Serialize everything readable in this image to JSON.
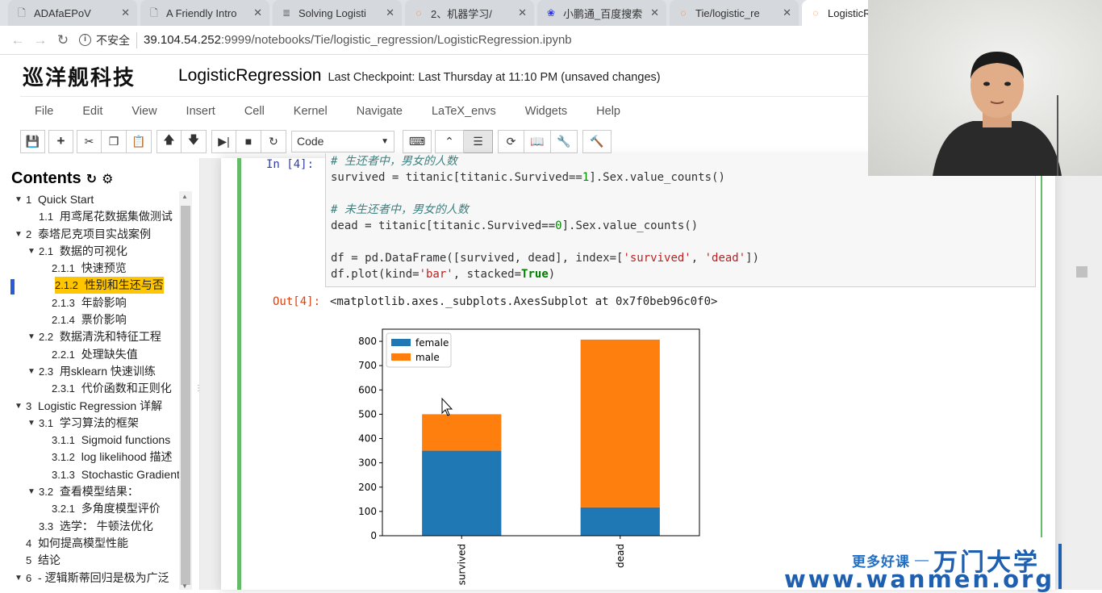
{
  "browser": {
    "tabs": [
      {
        "label": "ADAfaEPoV",
        "icon": "page-icon"
      },
      {
        "label": "A Friendly Intro",
        "icon": "page-icon"
      },
      {
        "label": "Solving Logisti",
        "icon": "doc-icon"
      },
      {
        "label": "2、机器学习/",
        "icon": "jupyter-icon"
      },
      {
        "label": "小鹏通_百度搜索",
        "icon": "baidu-icon"
      },
      {
        "label": "Tie/logistic_re",
        "icon": "jupyter-icon"
      },
      {
        "label": "LogisticRegres",
        "icon": "jupyter-icon"
      }
    ],
    "security_label": "不安全",
    "url_host": "39.104.54.252",
    "url_path": ":9999/notebooks/Tie/logistic_regression/LogisticRegression.ipynb"
  },
  "header": {
    "logo": "巡洋舰科技",
    "notebook_name": "LogisticRegression",
    "checkpoint": "Last Checkpoint: Last Thursday at 11:10 PM (unsaved changes)"
  },
  "menu": [
    "File",
    "Edit",
    "View",
    "Insert",
    "Cell",
    "Kernel",
    "Navigate",
    "LaTeX_envs",
    "Widgets",
    "Help"
  ],
  "toolbar": {
    "cell_type": "Code"
  },
  "toc": {
    "title": "Contents",
    "items": [
      {
        "num": "1",
        "text": "Quick Start",
        "level": 1,
        "arrow": true
      },
      {
        "num": "1.1",
        "text": "用鸢尾花数据集做测试",
        "level": 2,
        "arrow": false
      },
      {
        "num": "2",
        "text": "泰塔尼克项目实战案例",
        "level": 1,
        "arrow": true
      },
      {
        "num": "2.1",
        "text": "数据的可视化",
        "level": 2,
        "arrow": true
      },
      {
        "num": "2.1.1",
        "text": "快速预览",
        "level": 3,
        "arrow": false
      },
      {
        "num": "2.1.2",
        "text": "性别和生还与否",
        "level": 3,
        "arrow": false,
        "active": true
      },
      {
        "num": "2.1.3",
        "text": "年龄影响",
        "level": 3,
        "arrow": false
      },
      {
        "num": "2.1.4",
        "text": "票价影响",
        "level": 3,
        "arrow": false
      },
      {
        "num": "2.2",
        "text": "数据清洗和特征工程",
        "level": 2,
        "arrow": true
      },
      {
        "num": "2.2.1",
        "text": "处理缺失值",
        "level": 3,
        "arrow": false
      },
      {
        "num": "2.3",
        "text": "用sklearn 快速训练",
        "level": 2,
        "arrow": true
      },
      {
        "num": "2.3.1",
        "text": "代价函数和正则化",
        "level": 3,
        "arrow": false
      },
      {
        "num": "3",
        "text": "Logistic Regression 详解",
        "level": 1,
        "arrow": true
      },
      {
        "num": "3.1",
        "text": "学习算法的框架",
        "level": 2,
        "arrow": true
      },
      {
        "num": "3.1.1",
        "text": "Sigmoid functions",
        "level": 3,
        "arrow": false
      },
      {
        "num": "3.1.2",
        "text": "log likelihood 描述",
        "level": 3,
        "arrow": false
      },
      {
        "num": "3.1.3",
        "text": "Stochastic Gradient",
        "level": 3,
        "arrow": false
      },
      {
        "num": "3.2",
        "text": "查看模型结果：",
        "level": 2,
        "arrow": true
      },
      {
        "num": "3.2.1",
        "text": "多角度模型评价",
        "level": 3,
        "arrow": false
      },
      {
        "num": "3.3",
        "text": "选学： 牛顿法优化",
        "level": 2,
        "arrow": false
      },
      {
        "num": "4",
        "text": "如何提高模型性能",
        "level": 1,
        "arrow": false
      },
      {
        "num": "5",
        "text": "结论",
        "level": 1,
        "arrow": false
      },
      {
        "num": "6",
        "text": "- 逻辑斯蒂回归是极为广泛",
        "level": 1,
        "arrow": true
      }
    ]
  },
  "cell": {
    "in_prompt": "In  [4]:",
    "out_prompt": "Out[4]:",
    "code_lines": [
      [
        {
          "t": "# 生还者中，男女的人数",
          "c": "com"
        }
      ],
      [
        {
          "t": "survived = titanic[titanic.Survived==",
          "c": ""
        },
        {
          "t": "1",
          "c": "num"
        },
        {
          "t": "].Sex.value_counts()",
          "c": ""
        }
      ],
      [
        {
          "t": "",
          "c": ""
        }
      ],
      [
        {
          "t": "# 未生还者中，男女的人数",
          "c": "com"
        }
      ],
      [
        {
          "t": "dead = titanic[titanic.Survived==",
          "c": ""
        },
        {
          "t": "0",
          "c": "num"
        },
        {
          "t": "].Sex.value_counts()",
          "c": ""
        }
      ],
      [
        {
          "t": "",
          "c": ""
        }
      ],
      [
        {
          "t": "df = pd.DataFrame([survived, dead], index=[",
          "c": ""
        },
        {
          "t": "'survived'",
          "c": "str"
        },
        {
          "t": ", ",
          "c": ""
        },
        {
          "t": "'dead'",
          "c": "str"
        },
        {
          "t": "])",
          "c": ""
        }
      ],
      [
        {
          "t": "df.plot(kind=",
          "c": ""
        },
        {
          "t": "'bar'",
          "c": "str"
        },
        {
          "t": ", stacked=",
          "c": ""
        },
        {
          "t": "True",
          "c": "kw"
        },
        {
          "t": ")",
          "c": ""
        }
      ]
    ],
    "output_text": "<matplotlib.axes._subplots.AxesSubplot at 0x7f0beb96c0f0>"
  },
  "chart_data": {
    "type": "bar",
    "stacked": true,
    "categories": [
      "survived",
      "dead"
    ],
    "series": [
      {
        "name": "female",
        "values": [
          350,
          117
        ],
        "color": "#1f77b4"
      },
      {
        "name": "male",
        "values": [
          150,
          690
        ],
        "color": "#ff7f0e"
      }
    ],
    "ylim": [
      0,
      850
    ],
    "yticks": [
      0,
      100,
      200,
      300,
      400,
      500,
      600,
      700,
      800
    ],
    "legend": "top-left",
    "grid": false
  },
  "watermark": {
    "small": "更多好课",
    "dash": "—",
    "brand": "万门大学",
    "url": "www.wanmen.org"
  },
  "colors": {
    "cell_selected": "#66bb6a",
    "toc_highlight": "#ffc600",
    "brand_blue": "#1e5fb0"
  }
}
